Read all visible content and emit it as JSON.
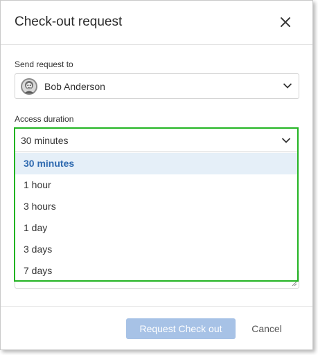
{
  "dialog": {
    "title": "Check-out request",
    "close_icon": "close-icon"
  },
  "recipient": {
    "label": "Send request to",
    "name": "Bob Anderson",
    "avatar_icon": "user-avatar-icon"
  },
  "duration": {
    "label": "Access duration",
    "selected": "30 minutes",
    "options": [
      {
        "label": "30 minutes",
        "selected": true
      },
      {
        "label": "1 hour",
        "selected": false
      },
      {
        "label": "3 hours",
        "selected": false
      },
      {
        "label": "1 day",
        "selected": false
      },
      {
        "label": "3 days",
        "selected": false
      },
      {
        "label": "7 days",
        "selected": false
      }
    ]
  },
  "footer": {
    "submit_label": "Request Check out",
    "cancel_label": "Cancel"
  },
  "colors": {
    "highlight_border": "#22b422",
    "selected_text": "#2f6ab0",
    "selected_bg": "#e5eff8",
    "primary_disabled": "#a7c2e6"
  }
}
